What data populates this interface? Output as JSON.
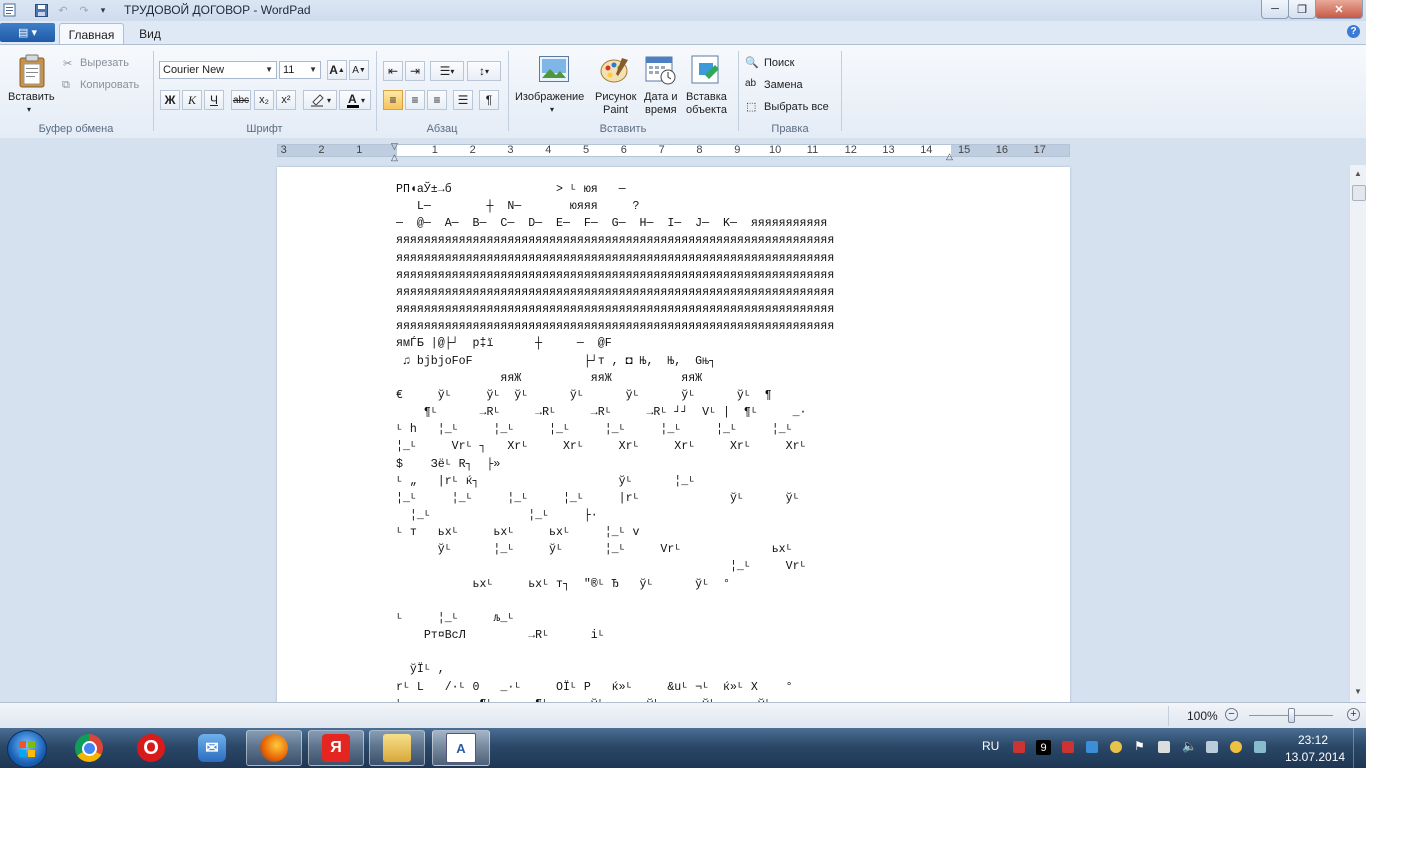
{
  "window": {
    "title": "ТРУДОВОЙ ДОГОВОР - WordPad",
    "minimize": "─",
    "maximize": "❐",
    "close": "✕"
  },
  "tabs": {
    "app_menu": "▤ ▾",
    "home": "Главная",
    "view": "Вид"
  },
  "ribbon": {
    "clipboard": {
      "label": "Буфер обмена",
      "paste": "Вставить",
      "cut": "Вырезать",
      "copy": "Копировать"
    },
    "font": {
      "label": "Шрифт",
      "family": "Courier New",
      "size": "11",
      "grow": "A",
      "shrink": "A",
      "bold": "Ж",
      "italic": "К",
      "underline": "Ч",
      "strike": "abc",
      "subscript": "x₂",
      "superscript": "x²"
    },
    "paragraph": {
      "label": "Абзац"
    },
    "insert": {
      "label": "Вставить",
      "picture": "Изображение",
      "paint_1": "Рисунок",
      "paint_2": "Paint",
      "datetime_1": "Дата и",
      "datetime_2": "время",
      "object_1": "Вставка",
      "object_2": "объекта"
    },
    "editing": {
      "label": "Правка",
      "find": "Поиск",
      "replace": "Замена",
      "select_all": "Выбрать все"
    }
  },
  "ruler": {
    "ticks": [
      "3",
      "2",
      "1",
      "1",
      "2",
      "3",
      "4",
      "5",
      "6",
      "7",
      "8",
      "9",
      "10",
      "11",
      "12",
      "13",
      "14",
      "15",
      "16",
      "17"
    ]
  },
  "document": {
    "lines": [
      "РП◖аЎ±→б               > ᴸ юя   ─",
      "   L─        ┼  N─       юяяя     ?",
      "─  @─  A─  B─  C─  D─  E─  F─  G─  H─  I─  J─  K─  яяяяяяяяяяя",
      "яяяяяяяяяяяяяяяяяяяяяяяяяяяяяяяяяяяяяяяяяяяяяяяяяяяяяяяяяяяяяяя",
      "яяяяяяяяяяяяяяяяяяяяяяяяяяяяяяяяяяяяяяяяяяяяяяяяяяяяяяяяяяяяяяя",
      "яяяяяяяяяяяяяяяяяяяяяяяяяяяяяяяяяяяяяяяяяяяяяяяяяяяяяяяяяяяяяяя",
      "яяяяяяяяяяяяяяяяяяяяяяяяяяяяяяяяяяяяяяяяяяяяяяяяяяяяяяяяяяяяяяя",
      "яяяяяяяяяяяяяяяяяяяяяяяяяяяяяяяяяяяяяяяяяяяяяяяяяяяяяяяяяяяяяяя",
      "яяяяяяяяяяяяяяяяяяяяяяяяяяяяяяяяяяяяяяяяяяяяяяяяяяяяяяяяяяяяяяя",
      "ямЃБ |@├┘  p‡ї      ┼     ─  @F",
      " ♫ bjbjoFoF                ├┘т , ◘ Њ,  Њ,  Gњ┐",
      "               яяЖ          яяЖ          яяЖ",
      "€     ўᴸ     ўᴸ  ўᴸ      ўᴸ      ўᴸ      ўᴸ      ўᴸ  ¶",
      "    ¶ᴸ      →Rᴸ     →Rᴸ     →Rᴸ     →Rᴸ ┘┘  Vᴸ |  ¶ᴸ     _·",
      "ᴸ h   ¦_ᴸ     ¦_ᴸ     ¦_ᴸ     ¦_ᴸ     ¦_ᴸ     ¦_ᴸ     ¦_ᴸ",
      "¦_ᴸ     Vrᴸ ┐   Xrᴸ     Xrᴸ     Xrᴸ     Xrᴸ     Xrᴸ     Xrᴸ",
      "$    Зёᴸ R┐  ├»",
      "ᴸ „   |rᴸ ќ┐                    ўᴸ      ¦_ᴸ",
      "¦_ᴸ     ¦_ᴸ     ¦_ᴸ     ¦_ᴸ     |rᴸ             ўᴸ      ўᴸ",
      "  ¦_ᴸ              ¦_ᴸ     ├·",
      "ᴸ т   ьxᴸ     ьxᴸ     ьxᴸ     ¦_ᴸ v",
      "      ўᴸ      ¦_ᴸ     ўᴸ      ¦_ᴸ     Vrᴸ             ьxᴸ",
      "                                                ¦_ᴸ     Vrᴸ",
      "           ьxᴸ     ьxᴸ т┐  \"®ᴸ Ђ   ўᴸ      ўᴸ  °",
      "",
      "ᴸ     ¦_ᴸ     љ_ᴸ",
      "    Рт¤ВсЛ         →Rᴸ      iᴸ",
      "",
      "  ўЇᴸ ,",
      "rᴸ L   /·ᴸ 0   _·ᴸ     OЇᴸ P   ќ»ᴸ     &uᴸ ¬ᴸ  ќ»ᴸ X    °",
      "ᴸ           ¶ᴸ      ¶ᴸ      ўᴸ      ўᴸ      ўᴸ      ўᴸ"
    ]
  },
  "statusbar": {
    "zoom": "100%",
    "zoom_out": "−",
    "zoom_in": "+"
  },
  "taskbar": {
    "yandex": "Я",
    "opera": "O",
    "language": "RU",
    "tray_badge": "9",
    "time": "23:12",
    "date": "13.07.2014"
  },
  "colors": {
    "ribbon_bg": "#e4ecf6",
    "accent": "#3f7fc9",
    "taskbar": "#2b4868"
  }
}
